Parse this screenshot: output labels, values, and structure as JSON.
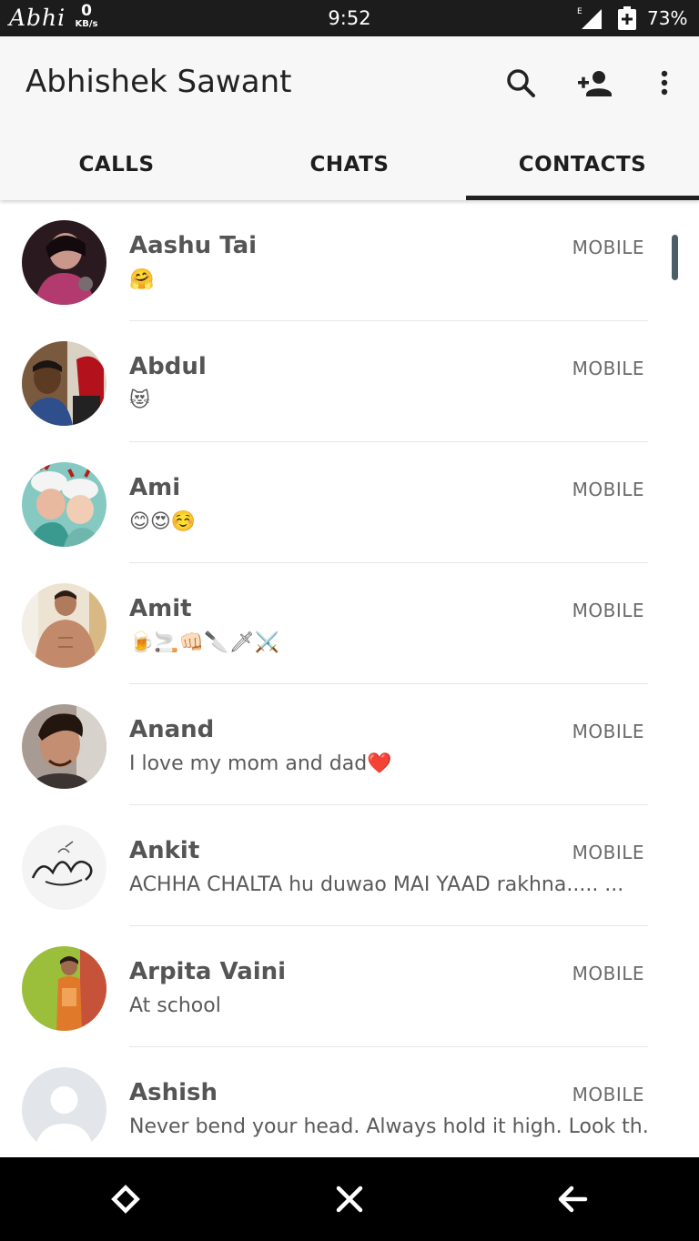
{
  "status_bar": {
    "carrier_name": "Abhi",
    "speed_value": "0",
    "speed_unit": "KB/s",
    "time": "9:52",
    "battery_percent": "73%",
    "icons": [
      "signal-icon",
      "battery-icon"
    ]
  },
  "app_bar": {
    "title": "Abhishek Sawant",
    "actions": [
      "search-icon",
      "add-contact-icon",
      "more-vert-icon"
    ]
  },
  "tabs": [
    {
      "label": "CALLS",
      "active": false
    },
    {
      "label": "CHATS",
      "active": false
    },
    {
      "label": "CONTACTS",
      "active": true
    }
  ],
  "contacts": [
    {
      "name": "Aashu Tai",
      "type": "MOBILE",
      "status": "🤗"
    },
    {
      "name": "Abdul",
      "type": "MOBILE",
      "status": "😻"
    },
    {
      "name": "Ami",
      "type": "MOBILE",
      "status": "😊😍☺️"
    },
    {
      "name": "Amit",
      "type": "MOBILE",
      "status": "🍺🚬👊🏻🔪🗡⚔️"
    },
    {
      "name": "Anand",
      "type": "MOBILE",
      "status": "I love my mom and dad❤️"
    },
    {
      "name": "Ankit",
      "type": "MOBILE",
      "status": " ACHHA CHALTA hu duwao MAI YAAD rakhna.....    ..."
    },
    {
      "name": "Arpita Vaini",
      "type": "MOBILE",
      "status": "At school"
    },
    {
      "name": "Ashish",
      "type": "MOBILE",
      "status": "Never bend your head. Always hold it high. Look th..."
    }
  ],
  "nav_bar": [
    "home-diamond-icon",
    "close-icon",
    "back-arrow-icon"
  ],
  "colors": {
    "status_bar_bg": "#1c1c1c",
    "app_bar_bg": "#f7f7f7",
    "tab_indicator": "#222222",
    "nav_bar_bg": "#000000",
    "scrollbar": "#4c5e66"
  }
}
